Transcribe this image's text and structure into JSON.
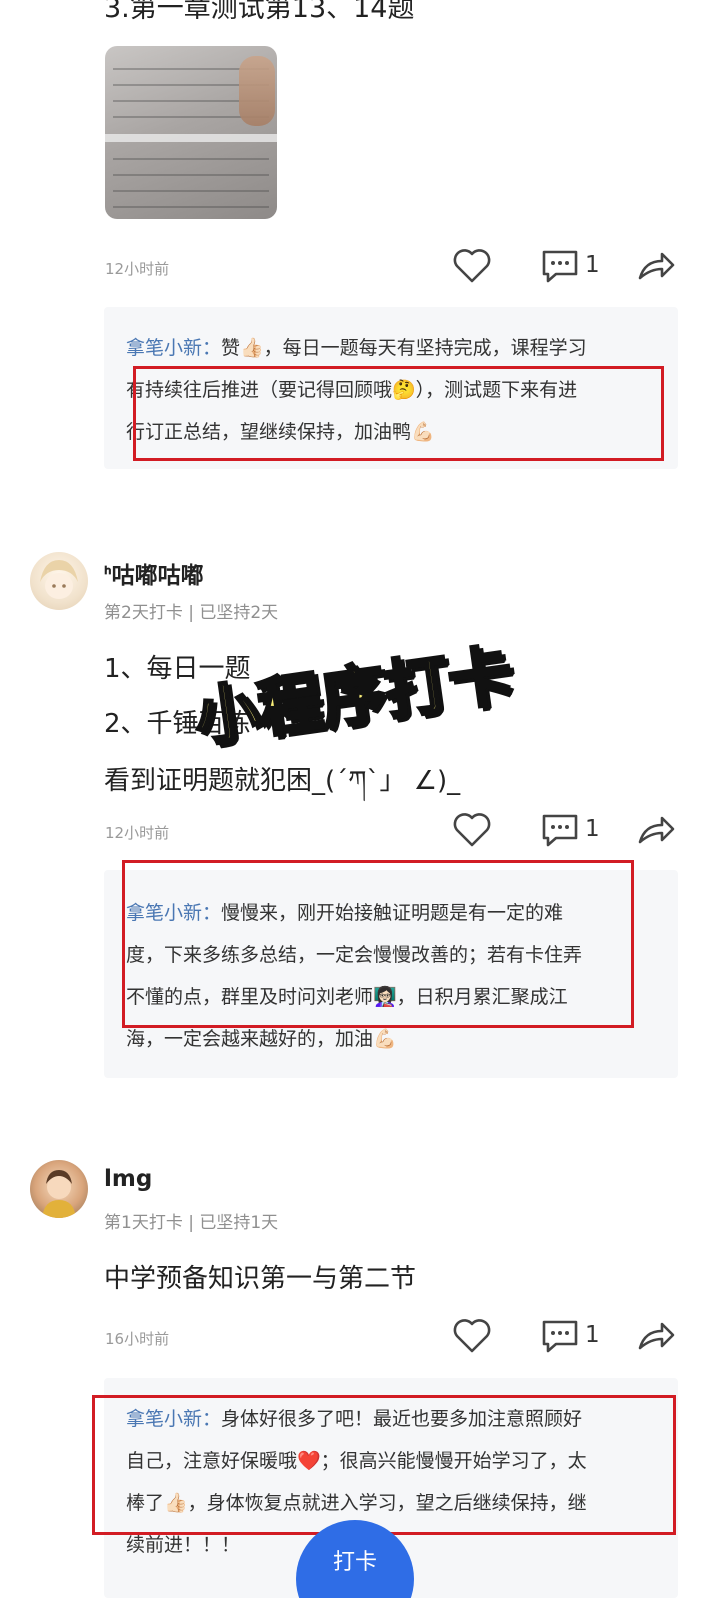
{
  "post1": {
    "text": "3.第一章测试第13、14题",
    "time": "12小时前",
    "comment_count": "1",
    "reply": {
      "author": "拿笔小新：",
      "lines": [
        "赞👍🏻，每日一题每天有坚持完成，课程学习",
        "有持续往后推进（要记得回顾哦🤔），测试题下来有进",
        "行订正总结，望继续保持，加油鸭💪🏻"
      ]
    }
  },
  "post2": {
    "username": "ᑋ咕嘟咕嘟",
    "meta": "第2天打卡 | 已坚持2天",
    "lines": [
      "1、每日一题",
      "2、千锤百炼",
      "看到证明题就犯困_(´ཀ`」 ∠)_"
    ],
    "time": "12小时前",
    "comment_count": "1",
    "reply": {
      "author": "拿笔小新：",
      "lines": [
        "慢慢来，刚开始接触证明题是有一定的难",
        "度，下来多练多总结，一定会慢慢改善的；若有卡住弄",
        "不懂的点，群里及时问刘老师👩🏻‍🏫，日积月累汇聚成江",
        "海，一定会越来越好的，加油💪🏻"
      ]
    }
  },
  "overlay": {
    "text": "小程序打卡"
  },
  "post3": {
    "username": "lmg",
    "meta": "第1天打卡 | 已坚持1天",
    "text": "中学预备知识第一与第二节",
    "time": "16小时前",
    "comment_count": "1",
    "reply": {
      "author": "拿笔小新：",
      "lines": [
        "身体好很多了吧！最近也要多加注意照顾好",
        "自己，注意好保暖哦❤️；很高兴能慢慢开始学习了，太",
        "棒了👍🏻，身体恢复点就进入学习，望之后继续保持，继",
        "续前进！！！"
      ]
    }
  },
  "fab": {
    "label": "打卡"
  },
  "colors": {
    "accent_blue": "#2f6de6",
    "author_blue": "#4a77b3",
    "frame_red": "#d21c24",
    "overlay_yellow": "#fbf07a"
  },
  "icons": [
    "heart-outline-icon",
    "comment-bubble-icon",
    "share-arrow-icon"
  ]
}
